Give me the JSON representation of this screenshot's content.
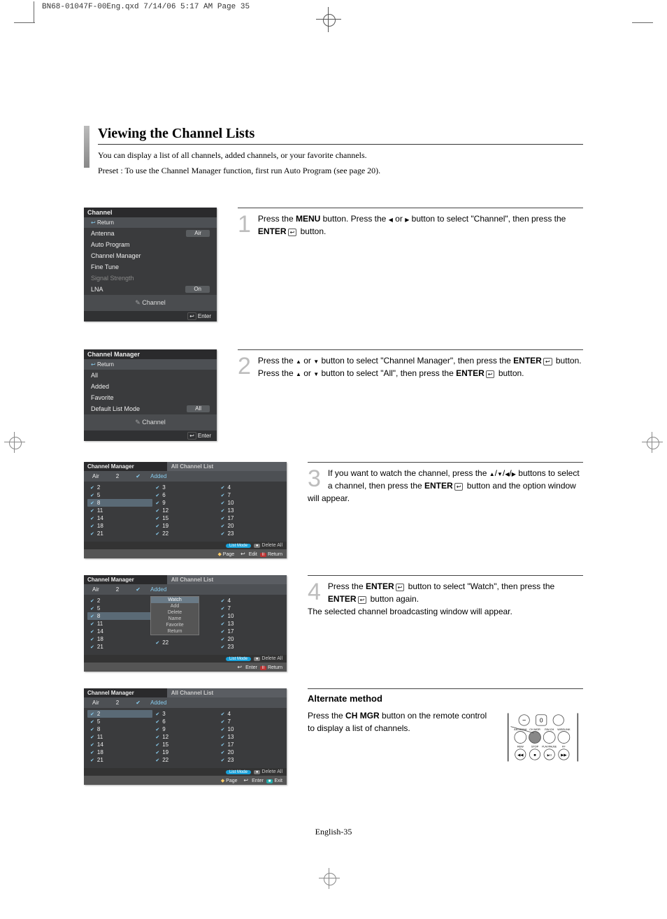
{
  "header_slug": "BN68-01047F-00Eng.qxd  7/14/06  5:17 AM  Page 35",
  "title": "Viewing the Channel Lists",
  "intro1": "You can display a list of all channels, added channels, or your favorite channels.",
  "intro2": "Preset : To use the Channel Manager function, first run Auto Program (see page 20).",
  "osd1": {
    "title": "Channel",
    "return": "Return",
    "rows": [
      {
        "label": "Antenna",
        "value": "Air",
        "dim": false
      },
      {
        "label": "Auto Program",
        "value": "",
        "dim": false
      },
      {
        "label": "Channel Manager",
        "value": "",
        "dim": false
      },
      {
        "label": "Fine Tune",
        "value": "",
        "dim": false
      },
      {
        "label": "Signal Strength",
        "value": "",
        "dim": true
      },
      {
        "label": "LNA",
        "value": "On",
        "dim": false
      }
    ],
    "footer": "Channel",
    "footer2": "Enter"
  },
  "step1_num": "1",
  "step1_a": "Press the ",
  "step1_b": " button. Press the ",
  "step1_c": " or ",
  "step1_d": " button to select \"Channel\", then press the ",
  "step1_e": " button.",
  "menu_label": "MENU",
  "enter_label": "ENTER",
  "osd2": {
    "title": "Channel Manager",
    "return": "Return",
    "items": [
      "All",
      "Added",
      "Favorite"
    ],
    "mode_label": "Default List Mode",
    "mode_value": "All",
    "footer": "Channel",
    "footer2": "Enter"
  },
  "step2_num": "2",
  "step2_a": "Press the ",
  "step2_b": " or ",
  "step2_c": " button to select \"Channel Manager\", then press the ",
  "step2_d": " button. Press the ",
  "step2_e": " or ",
  "step2_f": " button to select \"All\", then press the ",
  "step2_g": " button.",
  "listHeader": {
    "title": "Channel Manager",
    "subtitle": "All Channel List"
  },
  "listTabs": {
    "air": "Air",
    "num": "2",
    "added": "Added"
  },
  "cols": {
    "a": [
      "2",
      "5",
      "8",
      "11",
      "14",
      "18",
      "21"
    ],
    "b": [
      "3",
      "6",
      "9",
      "12",
      "15",
      "19",
      "22"
    ],
    "c": [
      "4",
      "7",
      "10",
      "13",
      "17",
      "20",
      "23"
    ]
  },
  "cols3_sel_index": 2,
  "bar1": {
    "list_mode": "List Mode",
    "delete_all": "Delete All"
  },
  "bar2_a": {
    "page": "Page",
    "edit": "Edit",
    "ret": "Return"
  },
  "bar2_b": {
    "enter": "Enter",
    "ret": "Return"
  },
  "bar2_c": {
    "page": "Page",
    "enter": "Enter",
    "exit": "Exit"
  },
  "ctx_menu": [
    "Watch",
    "Add",
    "Delete",
    "Name",
    "Favorite",
    "Return"
  ],
  "step3_num": "3",
  "step3_a": "If you want to watch the channel, press the ",
  "step3_b": " buttons to select a channel, then press the ",
  "step3_c": " button and the option window will appear.",
  "step4_num": "4",
  "step4_a": "Press the ",
  "step4_b": " button to select \"Watch\", then press the ",
  "step4_c": " button again.",
  "step4_d": "The selected channel broadcasting window will appear.",
  "alt_header": "Alternate method",
  "alt_a": "Press the ",
  "alt_b": " button on the remote control to display a list of channels.",
  "chmgr_label": "CH MGR",
  "remote_labels": {
    "minus": "−",
    "zero": "0",
    "plus": "",
    "antenna": "ANTENNA",
    "chmgr": "CH MGR",
    "favch": "FAV.CH",
    "wiselink": "WISELINK",
    "rew": "REW",
    "stop": "STOP",
    "play": "PLAY/PAUSE",
    "ff": "FF"
  },
  "page_num": "English-35"
}
